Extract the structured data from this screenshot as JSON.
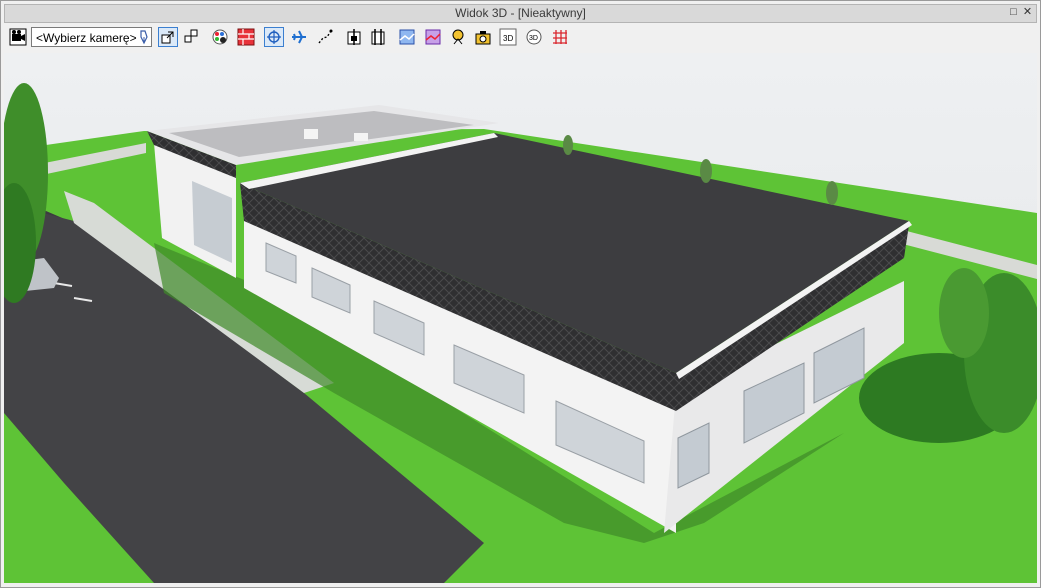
{
  "window": {
    "title": "Widok 3D - [Nieaktywny]",
    "restore_glyph": "□",
    "close_glyph": "✕"
  },
  "toolbar": {
    "camera_select": {
      "value": "<Wybierz kamerę>"
    },
    "buttons": [
      "camera-icon",
      "camera-select-dropdown",
      "camera-adjust-icon",
      "window-mode-1-icon",
      "window-mode-2-icon",
      "color-palette-icon",
      "walls-icon",
      "orbit-icon",
      "fly-icon",
      "walk-path-icon",
      "section-1-icon",
      "section-2-icon",
      "render-1-icon",
      "render-2-icon",
      "photo-1-icon",
      "photo-2-icon",
      "view-3d-icon",
      "rotate-3d-icon",
      "grid-3d-icon"
    ]
  },
  "colors": {
    "sky": "#eceef0",
    "grass": "#62c93a",
    "asphalt": "#4a4a4c",
    "roof": "#3d3d3f",
    "wall": "#f4f4f4",
    "fascia": "#2e2e30",
    "accent": "#3b7fd0"
  }
}
